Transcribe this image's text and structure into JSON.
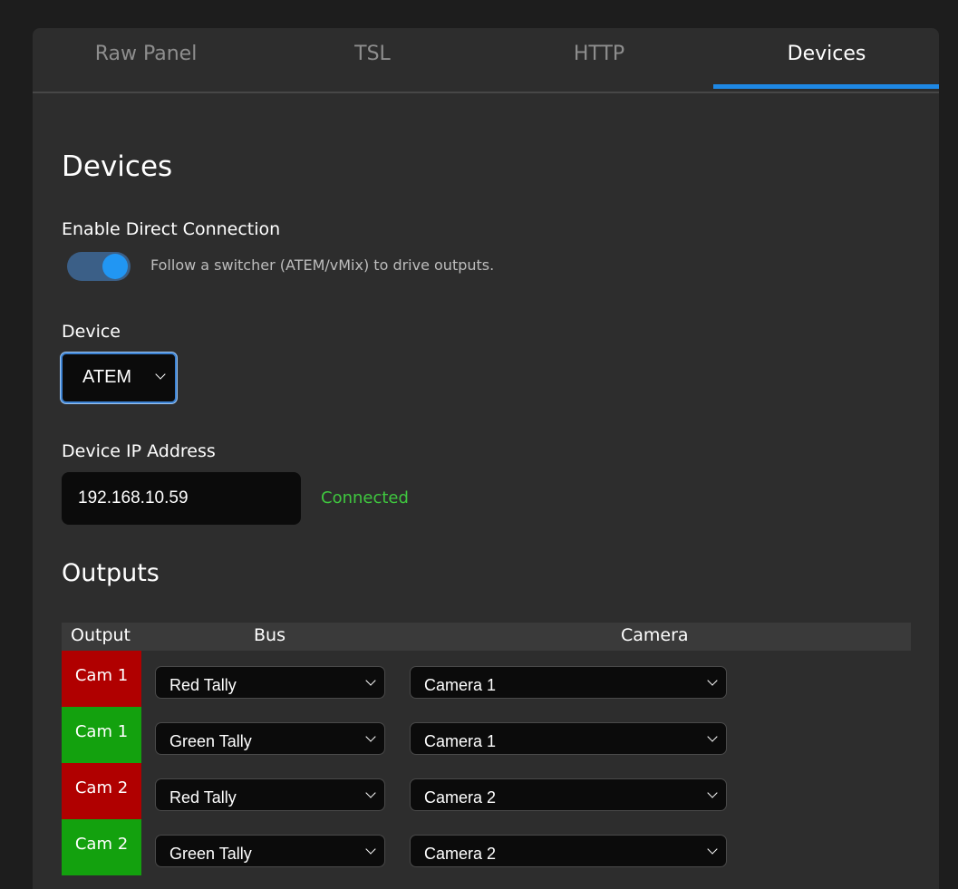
{
  "tabs": [
    {
      "label": "Raw Panel",
      "active": false
    },
    {
      "label": "TSL",
      "active": false
    },
    {
      "label": "HTTP",
      "active": false
    },
    {
      "label": "Devices",
      "active": true
    }
  ],
  "page": {
    "title": "Devices",
    "direct_connection": {
      "label": "Enable Direct Connection",
      "enabled": true,
      "hint": "Follow a switcher (ATEM/vMix) to drive outputs."
    },
    "device": {
      "label": "Device",
      "selected": "ATEM"
    },
    "ip": {
      "label": "Device IP Address",
      "value": "192.168.10.59",
      "status": "Connected"
    },
    "outputs": {
      "title": "Outputs",
      "headers": {
        "output": "Output",
        "bus": "Bus",
        "camera": "Camera"
      },
      "rows": [
        {
          "output": "Cam 1",
          "color": "#b00000",
          "bus": "Red Tally",
          "camera": "Camera 1"
        },
        {
          "output": "Cam 1",
          "color": "#13a10e",
          "bus": "Green Tally",
          "camera": "Camera 1"
        },
        {
          "output": "Cam 2",
          "color": "#b00000",
          "bus": "Red Tally",
          "camera": "Camera 2"
        },
        {
          "output": "Cam 2",
          "color": "#13a10e",
          "bus": "Green Tally",
          "camera": "Camera 2"
        }
      ]
    }
  },
  "colors": {
    "accent": "#1e88e5",
    "status_ok": "#3fc73f",
    "red_tally": "#b00000",
    "green_tally": "#13a10e"
  }
}
